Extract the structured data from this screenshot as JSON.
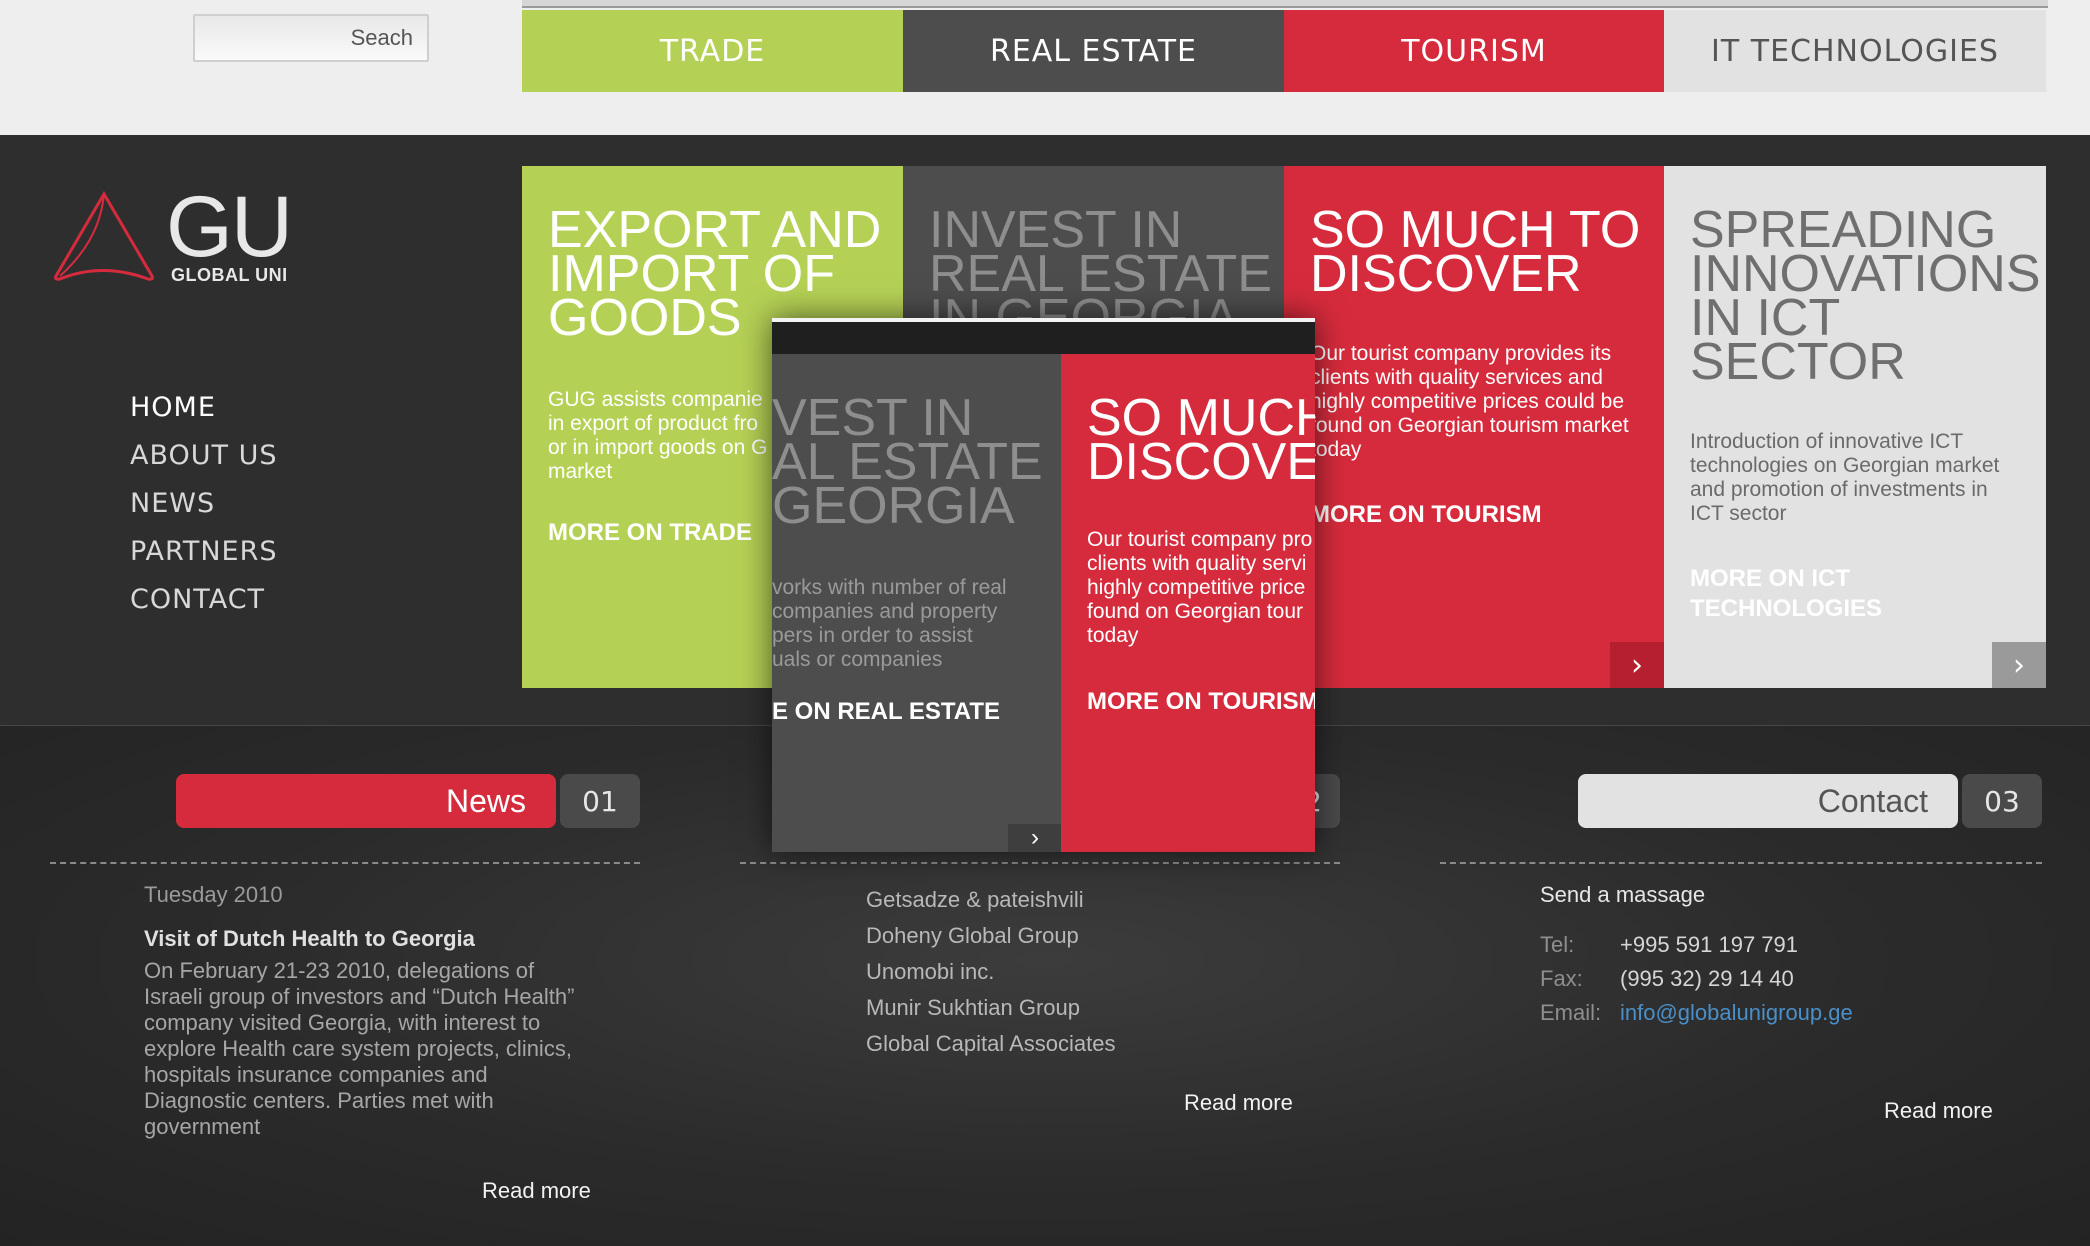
{
  "search": {
    "placeholder": "Seach"
  },
  "tabs": [
    {
      "label": "TRADE",
      "bg": "#b5d155",
      "color": "#ffffff"
    },
    {
      "label": "REAL ESTATE",
      "bg": "#4d4d4d",
      "color": "#ffffff"
    },
    {
      "label": "TOURISM",
      "bg": "#d62b3c",
      "color": "#ffffff"
    },
    {
      "label": "IT TECHNOLOGIES",
      "bg": "#e2e2e2",
      "color": "#555555"
    }
  ],
  "logo": {
    "mark": "GU",
    "name": "GLOBAL UNI"
  },
  "nav": [
    "HOME",
    "ABOUT US",
    "NEWS",
    "PARTNERS",
    "CONTACT"
  ],
  "panels": {
    "trade": {
      "heading": [
        "EXPORT AND",
        "IMPORT OF",
        "GOODS"
      ],
      "text": [
        "GUG assists companie",
        "in export of product fro",
        "or in import goods on G",
        "market"
      ],
      "more": "MORE ON TRADE"
    },
    "realestate": {
      "heading": [
        "INVEST IN",
        "REAL ESTATE",
        "IN GEORGIA"
      ]
    },
    "tourism": {
      "heading": [
        "SO MUCH TO",
        "DISCOVER"
      ],
      "text": [
        "Our tourist company provides its",
        "clients with quality services and",
        "highly competitive prices could be",
        "found on Georgian tourism market",
        "today"
      ],
      "more": "MORE ON TOURISM"
    },
    "ict": {
      "heading": [
        "SPREADING",
        "INNOVATIONS",
        "IN ICT",
        "SECTOR"
      ],
      "text": [
        "Introduction of innovative ICT",
        "technologies on Georgian market",
        "and promotion of investments in",
        "ICT sector"
      ],
      "more": [
        "MORE ON ICT",
        "TECHNOLOGIES"
      ]
    }
  },
  "overlay": {
    "realestate": {
      "heading": [
        "VEST IN",
        "AL ESTATE",
        "GEORGIA"
      ],
      "text": [
        "vorks with number of real",
        "companies and property",
        "pers in order to assist",
        "uals or companies"
      ],
      "more": "E ON REAL ESTATE"
    },
    "tourism": {
      "heading": [
        "SO MUCH",
        "DISCOVE"
      ],
      "text": [
        "Our tourist company pro",
        "clients with quality servi",
        "highly competitive price",
        "found on Georgian tour",
        "today"
      ],
      "more": "MORE ON TOURISM"
    }
  },
  "news": {
    "title": "News",
    "num": "01",
    "date": "Tuesday 2010",
    "headline": "Visit of Dutch Health to Georgia",
    "body": [
      "On February 21-23 2010, delegations of",
      "Israeli group of investors and “Dutch Health”",
      "company visited Georgia, with interest to",
      "explore Health care system projects, clinics,",
      "hospitals insurance companies and",
      "Diagnostic centers. Parties met with",
      "government"
    ],
    "read_more": "Read more"
  },
  "partners": {
    "num": "2",
    "items": [
      "Getsadze & pateishvili",
      "Doheny Global Group",
      "Unomobi inc.",
      "Munir Sukhtian Group",
      "Global Capital Associates"
    ],
    "read_more": "Read more"
  },
  "contact": {
    "title": "Contact",
    "num": "03",
    "send": "Send a massage",
    "tel_label": "Tel:",
    "tel": "+995 591 197 791",
    "fax_label": "Fax:",
    "fax": "(995 32) 29 14 40",
    "email_label": "Email:",
    "email": "info@globalunigroup.ge",
    "read_more": "Read more"
  },
  "colors": {
    "green": "#b5d155",
    "gray": "#4d4d4d",
    "red": "#d62b3c",
    "light": "#e2e2e2",
    "link": "#4a8fc7"
  }
}
